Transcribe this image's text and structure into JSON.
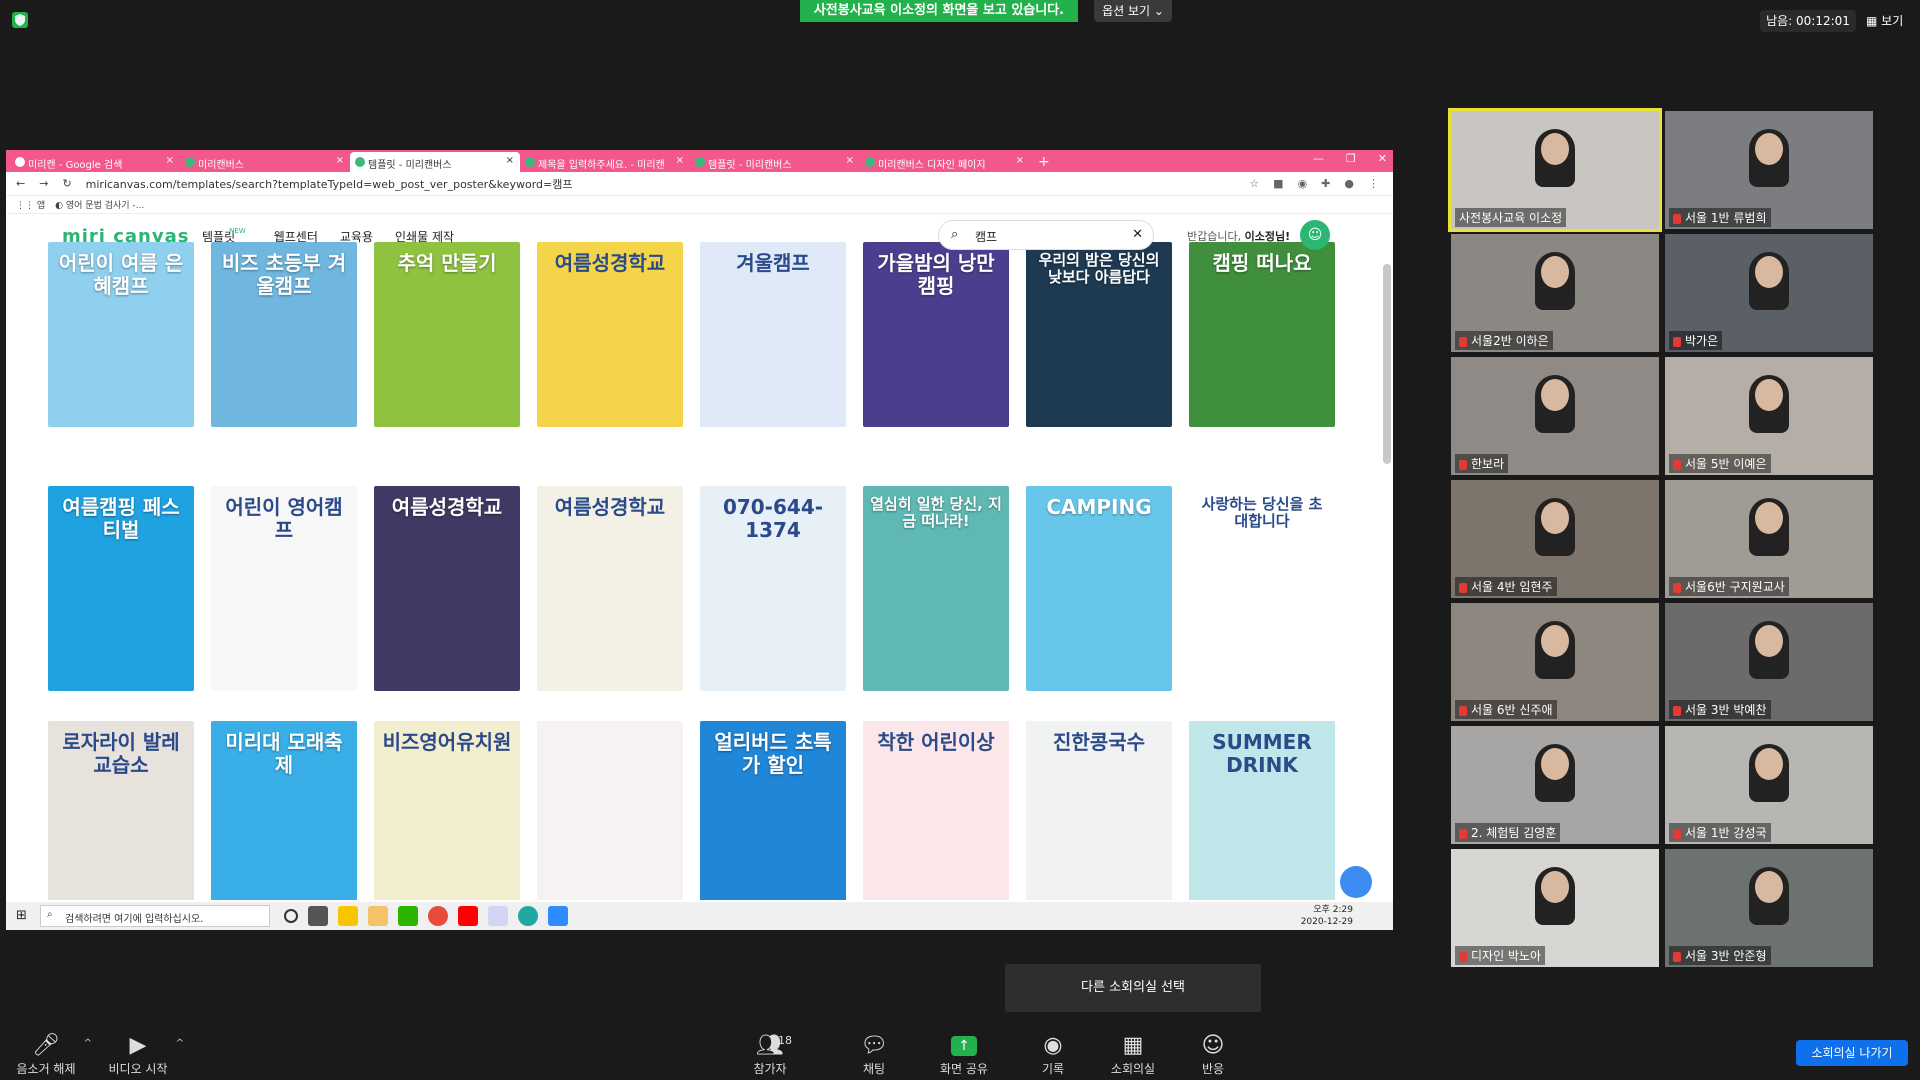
{
  "zoom_top": {
    "share_banner": "사전봉사교육 이소정의 화면을 보고 있습니다.",
    "view_options": "옵션 보기 ⌄",
    "timer": "남음: 00:12:01",
    "view_label": "보기"
  },
  "browser": {
    "tabs": [
      {
        "label": "미리캔 - Google 검색",
        "active": false
      },
      {
        "label": "미리캔버스",
        "active": false
      },
      {
        "label": "템플릿 - 미리캔버스",
        "active": true
      },
      {
        "label": "제목을 입력하주세요. - 미리캔",
        "active": false
      },
      {
        "label": "템플릿 - 미리캔버스",
        "active": false
      },
      {
        "label": "미리캔버스 디자인 페이지",
        "active": false
      }
    ],
    "url": "miricanvas.com/templates/search?templateTypeId=web_post_ver_poster&keyword=캠프",
    "bookmarks": [
      "앱",
      "영어 문법 검사기 -..."
    ]
  },
  "site": {
    "logo": "miri canvas",
    "nav": [
      "템플릿",
      "웹프센터",
      "교육용",
      "인쇄물 제작"
    ],
    "nav_new_badge": "NEW",
    "search_value": "캠프",
    "greeting_prefix": "반갑습니다,",
    "greeting_user": "이소정님!",
    "templates": [
      {
        "title": "어린이 여름 은혜캠프",
        "color": "#8fd0ee"
      },
      {
        "title": "비즈 초등부 겨울캠프",
        "color": "#6fb7df"
      },
      {
        "title": "추억 만들기",
        "color": "#8fc23f"
      },
      {
        "title": "여름성경학교",
        "color": "#f4d54a"
      },
      {
        "title": "겨울캠프",
        "color": "#dfe9f7"
      },
      {
        "title": "가을밤의 낭만캠핑",
        "color": "#4a3f8f"
      },
      {
        "title": "우리의 밤은 당신의 낮보다 아름답다",
        "color": "#1d3a52"
      },
      {
        "title": "캠핑 떠나요",
        "color": "#3f8f3c"
      },
      {
        "title": "여름캠핑 페스티벌",
        "color": "#1fa2e0"
      },
      {
        "title": "어린이 영어캠프",
        "color": "#f7f7f7"
      },
      {
        "title": "여름성경학교",
        "color": "#3e3a63"
      },
      {
        "title": "여름성경학교",
        "color": "#f3f1e6"
      },
      {
        "title": "070-644-1374",
        "color": "#e7f0f7"
      },
      {
        "title": "열심히 일한 당신, 지금 떠나라!",
        "color": "#5fb8b3"
      },
      {
        "title": "CAMPING",
        "color": "#68c6ea"
      },
      {
        "title": "사랑하는 당신을 초대합니다",
        "color": "#ffffff"
      },
      {
        "title": "로자라이 발레교습소",
        "color": "#e8e2dc"
      },
      {
        "title": "미리대 모래축제",
        "color": "#3aaee6"
      },
      {
        "title": "비즈영어유치원",
        "color": "#f3eecf"
      },
      {
        "title": "",
        "color": "#f6f2f4"
      },
      {
        "title": "얼리버드 초특가 할인",
        "color": "#1f86d8"
      },
      {
        "title": "착한 어린이상",
        "color": "#fbe7ea"
      },
      {
        "title": "진한콩국수",
        "color": "#f1f3f2"
      },
      {
        "title": "SUMMER DRINK",
        "color": "#bfe6e8"
      }
    ]
  },
  "taskbar": {
    "search_placeholder": "검색하려면 여기에 입력하십시오.",
    "time": "오후 2:29",
    "date": "2020-12-29"
  },
  "participants": [
    {
      "name": "사전봉사교육 이소정",
      "active": true,
      "muted": false
    },
    {
      "name": "서울 1반 류범희",
      "active": false,
      "muted": true
    },
    {
      "name": "서울2반 이하은",
      "active": false,
      "muted": true
    },
    {
      "name": "박가은",
      "active": false,
      "muted": true
    },
    {
      "name": "한보라",
      "active": false,
      "muted": true
    },
    {
      "name": "서울 5반 이예은",
      "active": false,
      "muted": true
    },
    {
      "name": "서울 4반 임현주",
      "active": false,
      "muted": true
    },
    {
      "name": "서울6반 구지원교사",
      "active": false,
      "muted": true
    },
    {
      "name": "서울 6반 신주애",
      "active": false,
      "muted": true
    },
    {
      "name": "서울 3반 박예찬",
      "active": false,
      "muted": true
    },
    {
      "name": "2. 체험팀 김영훈",
      "active": false,
      "muted": true
    },
    {
      "name": "서울 1반 강성국",
      "active": false,
      "muted": true
    },
    {
      "name": "디자인 박노아",
      "active": false,
      "muted": true
    },
    {
      "name": "서울 3반 안준형",
      "active": false,
      "muted": true
    }
  ],
  "breakout_popup": "다른 소회의실 선택",
  "toolbar": {
    "mute": "음소거 해제",
    "video": "비디오 시작",
    "participants": "참가자",
    "participant_count": "18",
    "chat": "채팅",
    "share": "화면 공유",
    "record": "기록",
    "breakout": "소회의실",
    "reactions": "반응",
    "leave": "소회의실 나가기"
  }
}
